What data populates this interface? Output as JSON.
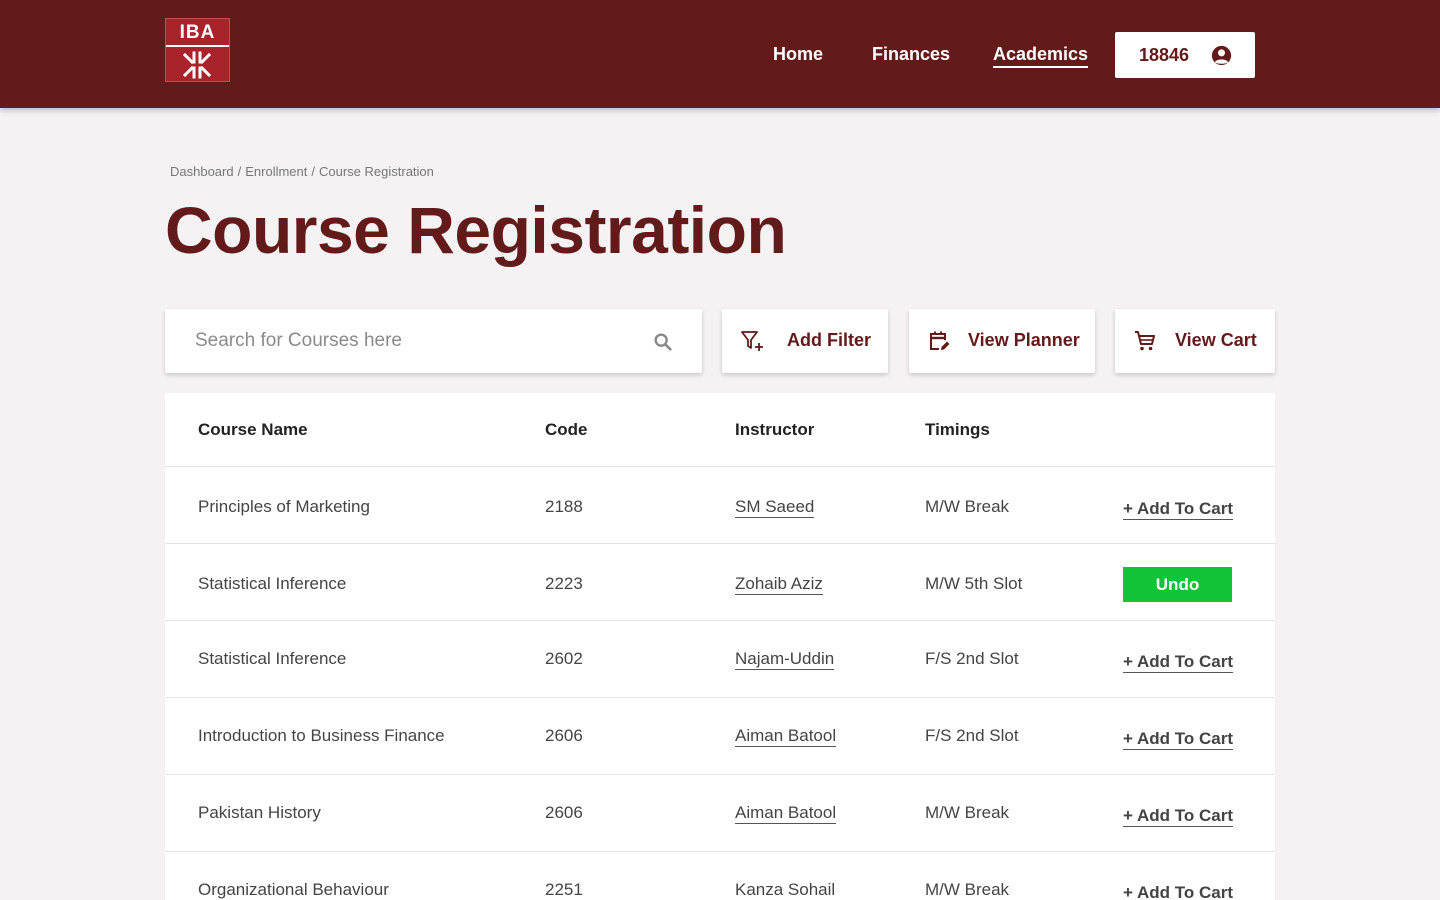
{
  "header": {
    "logo_text": "IBA",
    "nav": [
      "Home",
      "Finances",
      "Academics"
    ],
    "active_nav": "Academics",
    "user_id": "18846",
    "brand_color": "#631a1b"
  },
  "breadcrumb": [
    "Dashboard",
    "Enrollment",
    "Course Registration"
  ],
  "page_title": "Course Registration",
  "toolbar": {
    "search_placeholder": "Search for Courses here",
    "search_value": "",
    "filter_label": "Add Filter",
    "planner_label": "View Planner",
    "cart_label": "View Cart",
    "icons": [
      "search-icon",
      "filter-plus-icon",
      "calendar-edit-icon",
      "cart-icon"
    ]
  },
  "table": {
    "headers": [
      "Course Name",
      "Code",
      "Instructor",
      "Timings"
    ],
    "add_label": "+ Add To Cart",
    "undo_label": "Undo",
    "undo_color": "#13c337",
    "rows": [
      {
        "course": "Principles of Marketing",
        "code": "2188",
        "instructor": "SM Saeed",
        "timing": "M/W Break",
        "action": "+ Add To Cart"
      },
      {
        "course": "Statistical Inference",
        "code": "2223",
        "instructor": "Zohaib Aziz",
        "timing": "M/W 5th Slot",
        "action": "Undo"
      },
      {
        "course": "Statistical Inference",
        "code": "2602",
        "instructor": "Najam-Uddin",
        "timing": "F/S 2nd Slot",
        "action": "+ Add To Cart"
      },
      {
        "course": "Introduction to Business Finance",
        "code": "2606",
        "instructor": "Aiman Batool",
        "timing": "F/S 2nd Slot",
        "action": "+ Add To Cart"
      },
      {
        "course": "Pakistan History",
        "code": "2606",
        "instructor": "Aiman Batool",
        "timing": "M/W Break",
        "action": "+ Add To Cart"
      },
      {
        "course": "Organizational Behaviour",
        "code": "2251",
        "instructor": "Kanza Sohail",
        "timing": "M/W Break",
        "action": "+ Add To Cart"
      }
    ]
  }
}
